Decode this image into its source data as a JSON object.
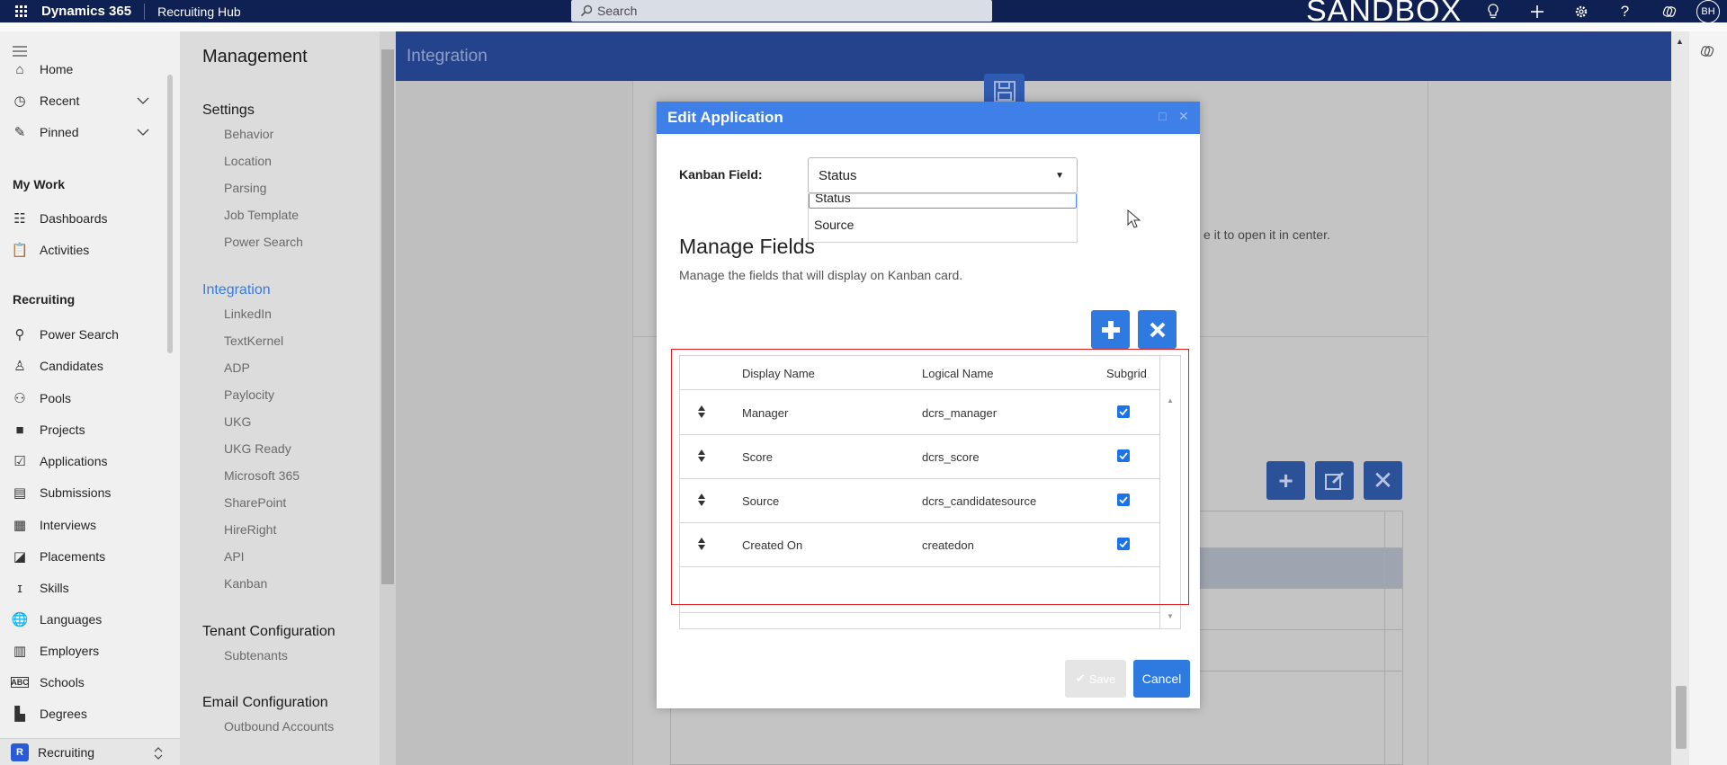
{
  "topbar": {
    "app_name": "Dynamics 365",
    "hub_name": "Recruiting Hub",
    "search_placeholder": "Search",
    "environment_label": "SANDBOX",
    "user_initials": "BH"
  },
  "leftnav": {
    "items_top": [
      {
        "label": "Home",
        "icon": "home-icon"
      },
      {
        "label": "Recent",
        "icon": "clock-icon"
      },
      {
        "label": "Pinned",
        "icon": "pin-icon"
      }
    ],
    "my_work_header": "My Work",
    "my_work": [
      {
        "label": "Dashboards",
        "icon": "dashboard-icon"
      },
      {
        "label": "Activities",
        "icon": "clipboard-icon"
      }
    ],
    "recruiting_header": "Recruiting",
    "recruiting": [
      {
        "label": "Power Search",
        "icon": "search-icon"
      },
      {
        "label": "Candidates",
        "icon": "person-icon"
      },
      {
        "label": "Pools",
        "icon": "group-icon"
      },
      {
        "label": "Projects",
        "icon": "briefcase-icon"
      },
      {
        "label": "Applications",
        "icon": "check-doc-icon"
      },
      {
        "label": "Submissions",
        "icon": "id-card-icon"
      },
      {
        "label": "Interviews",
        "icon": "calendar-icon"
      },
      {
        "label": "Placements",
        "icon": "placement-icon"
      },
      {
        "label": "Skills",
        "icon": "skills-icon"
      },
      {
        "label": "Languages",
        "icon": "globe-icon"
      },
      {
        "label": "Employers",
        "icon": "building-icon"
      },
      {
        "label": "Schools",
        "icon": "abc-icon"
      },
      {
        "label": "Degrees",
        "icon": "book-icon"
      }
    ],
    "area_badge": "R",
    "area_label": "Recruiting"
  },
  "management": {
    "title": "Management",
    "settings_header": "Settings",
    "settings": [
      "Behavior",
      "Location",
      "Parsing",
      "Job Template",
      "Power Search"
    ],
    "integration_header": "Integration",
    "integration": [
      "LinkedIn",
      "TextKernel",
      "ADP",
      "Paylocity",
      "UKG",
      "UKG Ready",
      "Microsoft 365",
      "SharePoint",
      "HireRight",
      "API",
      "Kanban"
    ],
    "tenant_header": "Tenant Configuration",
    "tenant": [
      "Subtenants"
    ],
    "email_header": "Email Configuration",
    "email": [
      "Outbound Accounts"
    ]
  },
  "main": {
    "title": "Integration",
    "hint_text": "e it to open it in center."
  },
  "dialog": {
    "title": "Edit Application",
    "kanban_label": "Kanban Field:",
    "kanban_value": "Status",
    "dropdown_options": [
      "Status",
      "Source"
    ],
    "manage_title": "Manage Fields",
    "manage_desc": "Manage the fields that will display on Kanban card.",
    "columns": {
      "display": "Display Name",
      "logical": "Logical Name",
      "subgrid": "Subgrid"
    },
    "rows": [
      {
        "display": "Manager",
        "logical": "dcrs_manager",
        "subgrid": true
      },
      {
        "display": "Score",
        "logical": "dcrs_score",
        "subgrid": true
      },
      {
        "display": "Source",
        "logical": "dcrs_candidatesource",
        "subgrid": true
      },
      {
        "display": "Created On",
        "logical": "createdon",
        "subgrid": true
      }
    ],
    "save_label": "Save",
    "cancel_label": "Cancel"
  },
  "colors": {
    "topbar": "#0f2052",
    "dialog_header": "#3f7fe8",
    "primary_button": "#2f7ae0",
    "highlight_box": "#e02020"
  }
}
